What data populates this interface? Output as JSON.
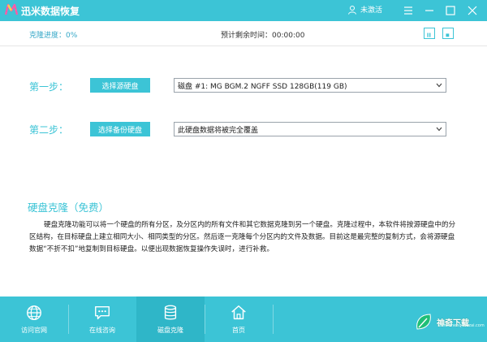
{
  "app": {
    "title": "迅米数据恢复",
    "user_label": "未激活",
    "colors": {
      "accent": "#3cc4d6",
      "accent_dark": "#2fb6c8",
      "text": "#222222"
    },
    "logo_icon": "m-logo-icon"
  },
  "status": {
    "progress_label": "克隆进度：0%",
    "time_label": "预计剩余时间：",
    "time_value": "00:00:00"
  },
  "step1": {
    "label": "第一步：",
    "button": "选择源硬盘",
    "selected": "磁盘 #1: MG BGM.2 NGFF SSD 128GB(119 GB)"
  },
  "step2": {
    "label": "第二步：",
    "button": "选择备份硬盘",
    "selected": "此硬盘数据将被完全覆盖"
  },
  "section": {
    "title": "硬盘克隆（免费）",
    "description": "硬盘克隆功能可以将一个硬盘的所有分区，及分区内的所有文件和其它数据克隆到另一个硬盘。克隆过程中，本软件将按源硬盘中的分区结构，在目标硬盘上建立相同大小、相同类型的分区。然后逐一克隆每个分区内的文件及数据。目前这是最完整的复制方式，会将源硬盘数据“不折不扣”地复制到目标硬盘。以便出现数据恢复操作失误时，进行补救。"
  },
  "bottom_nav": [
    {
      "label": "访问官网",
      "icon": "globe-icon"
    },
    {
      "label": "在线咨询",
      "icon": "chat-icon"
    },
    {
      "label": "磁盘克隆",
      "icon": "database-icon"
    },
    {
      "label": "首页",
      "icon": "home-icon"
    }
  ],
  "watermark": {
    "text": "神奇下载",
    "url": "www.shenqixiazai.com"
  }
}
